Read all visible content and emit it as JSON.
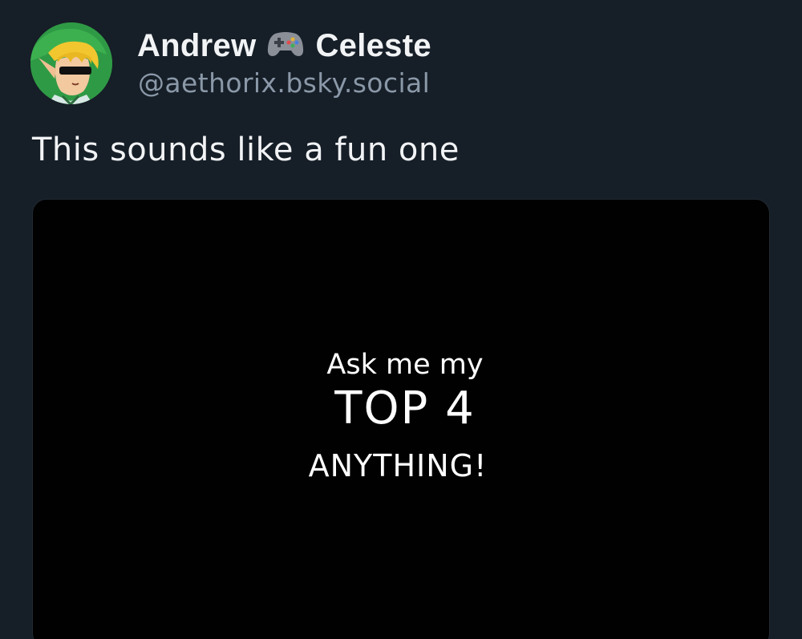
{
  "post": {
    "author": {
      "name_first": "Andrew",
      "name_emoji_icon": "video-game-controller-icon",
      "name_last": "Celeste",
      "handle": "@aethorix.bsky.social",
      "avatar_icon": "cartoon-elf-with-sunglasses-avatar"
    },
    "text": "This sounds like a fun one",
    "media": {
      "line1": "Ask me my",
      "line2": "TOP 4",
      "line3": "ANYTHING!"
    }
  },
  "colors": {
    "background": "#161e27",
    "primary_text": "#f1f3f5",
    "secondary_text": "#8a98a8",
    "media_background": "#010101"
  }
}
